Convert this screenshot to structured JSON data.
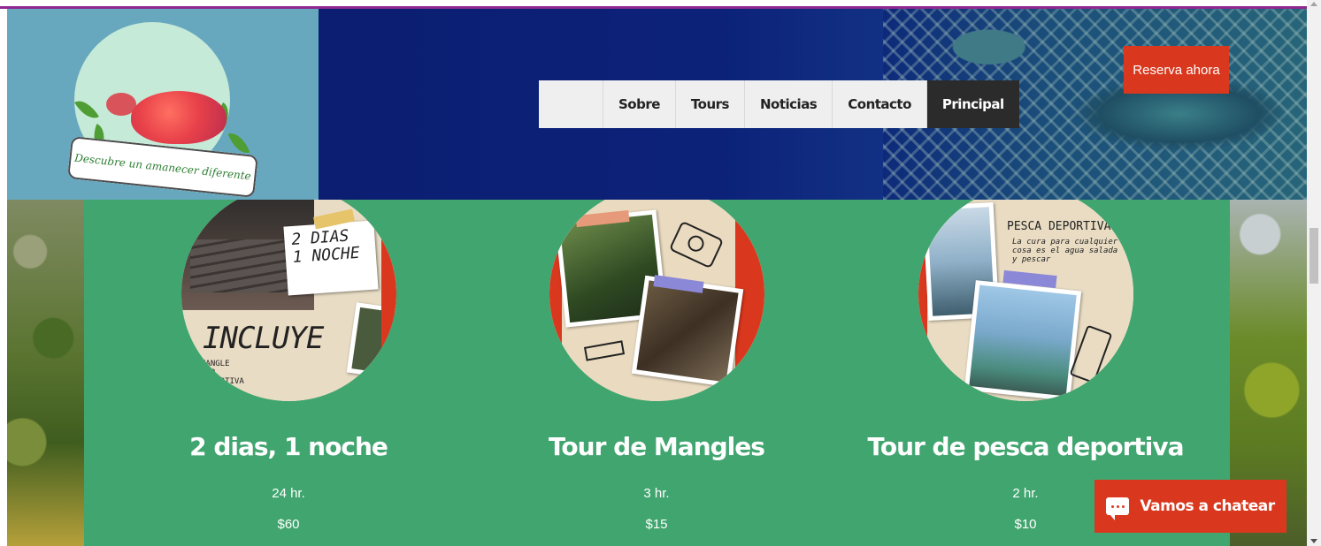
{
  "logo": {
    "tagline": "Descubre un amanecer diferente"
  },
  "nav": {
    "items": [
      {
        "label": "Sobre",
        "active": false
      },
      {
        "label": "Tours",
        "active": false
      },
      {
        "label": "Noticias",
        "active": false
      },
      {
        "label": "Contacto",
        "active": false
      },
      {
        "label": "Principal",
        "active": true
      }
    ]
  },
  "header": {
    "reserve_label": "Reserva ahora"
  },
  "tours": [
    {
      "title": "2 dias, 1 noche",
      "duration": "24 hr.",
      "price": "$60",
      "image_text": {
        "tag": "2 DIAS\n1 NOCHE",
        "main": "INCLUYE",
        "small": "MANGLE\nERO\nDEPORTIVA"
      }
    },
    {
      "title": "Tour de Mangles",
      "duration": "3 hr.",
      "price": "$15"
    },
    {
      "title": "Tour de pesca deportiva",
      "duration": "2 hr.",
      "price": "$10",
      "image_text": {
        "heading": "PESCA DEPORTIVA",
        "sub": "La cura para cualquier cosa es el agua salada y pescar"
      }
    }
  ],
  "chat": {
    "label": "Vamos a chatear",
    "icon": "chat-bubble-icon"
  },
  "colors": {
    "header_bg": "#0b1f6e",
    "logo_bg": "#67a8bf",
    "section_green": "#41a56f",
    "accent_red": "#d9381e",
    "nav_active": "#2b2b2b",
    "top_border": "#8e2a8f"
  }
}
